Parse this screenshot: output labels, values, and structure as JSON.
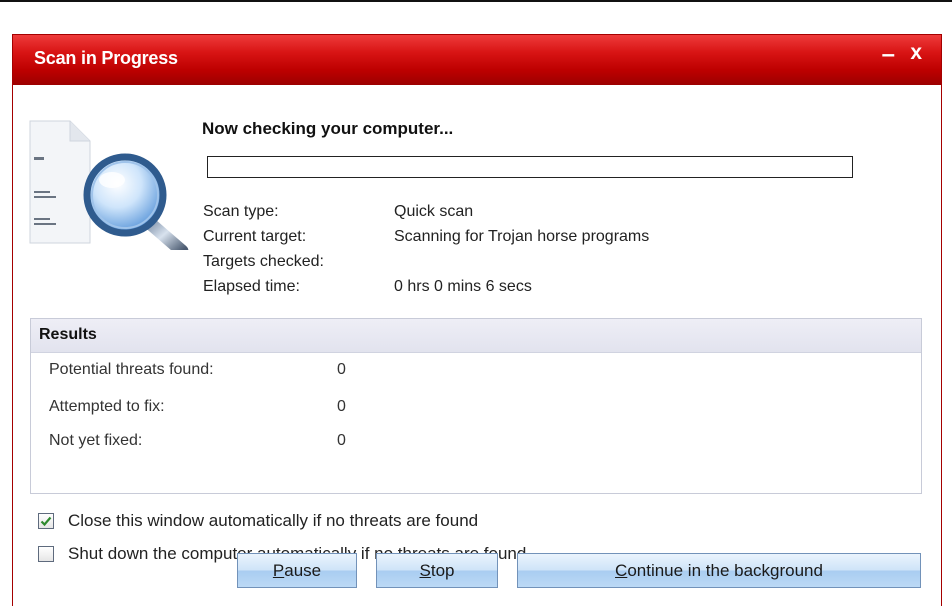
{
  "window": {
    "title": "Scan in Progress",
    "minimize_glyph": "–",
    "close_glyph": "x"
  },
  "scan": {
    "heading": "Now checking your computer...",
    "progress_percent": 0,
    "rows": [
      {
        "label": "Scan type:",
        "value": "Quick scan"
      },
      {
        "label": "Current target:",
        "value": "Scanning for Trojan horse programs"
      },
      {
        "label": "Targets checked:",
        "value": ""
      },
      {
        "label": "Elapsed time:",
        "value": "0 hrs 0 mins 6 secs"
      }
    ]
  },
  "results": {
    "title": "Results",
    "rows": [
      {
        "label": "Potential threats found:",
        "value": "0"
      },
      {
        "label": "Attempted to fix:",
        "value": "0"
      },
      {
        "label": "Not yet fixed:",
        "value": "0"
      }
    ]
  },
  "options": {
    "close_window": {
      "label": "Close this window automatically if no threats are found",
      "checked": true
    },
    "shutdown": {
      "label": "Shut down the computer automatically if no threats are found",
      "checked": false
    }
  },
  "buttons": {
    "pause": {
      "mnemonic": "P",
      "rest": "ause"
    },
    "stop": {
      "mnemonic": "S",
      "rest": "top"
    },
    "continue": {
      "mnemonic": "C",
      "rest": "ontinue in the background"
    }
  },
  "icons": {
    "scan_graphic": "magnifier-over-document-icon",
    "checkmark": "checkmark-icon"
  },
  "colors": {
    "titlebar": "#c80000",
    "check": "#2f8a2f",
    "button_border": "#7292b9"
  }
}
